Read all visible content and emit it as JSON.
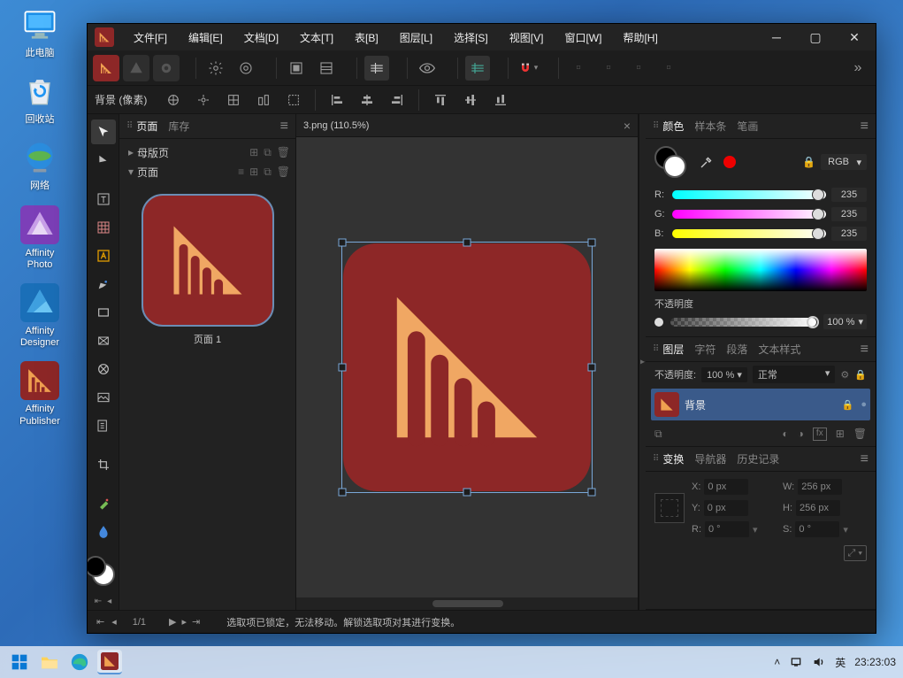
{
  "desktop": {
    "icons": [
      {
        "name": "此电脑"
      },
      {
        "name": "回收站"
      },
      {
        "name": "网络"
      },
      {
        "name": "Affinity\nPhoto"
      },
      {
        "name": "Affinity\nDesigner"
      },
      {
        "name": "Affinity\nPublisher"
      }
    ]
  },
  "menubar": {
    "items": [
      "文件[F]",
      "编辑[E]",
      "文档[D]",
      "文本[T]",
      "表[B]",
      "图层[L]",
      "选择[S]",
      "视图[V]",
      "窗口[W]",
      "帮助[H]"
    ]
  },
  "context": {
    "label": "背景 (像素)"
  },
  "pages_panel": {
    "tabs": [
      "页面",
      "库存"
    ],
    "tree": {
      "master": "母版页",
      "pages": "页面"
    },
    "thumb_label": "页面 1"
  },
  "document": {
    "tab": "3.png (110.5%)"
  },
  "color_panel": {
    "tabs": [
      "颜色",
      "样本条",
      "笔画"
    ],
    "mode": "RGB",
    "channels": [
      {
        "label": "R:",
        "value": "235"
      },
      {
        "label": "G:",
        "value": "235"
      },
      {
        "label": "B:",
        "value": "235"
      }
    ],
    "opacity_label": "不透明度",
    "opacity_value": "100 %"
  },
  "layers_panel": {
    "tabs": [
      "图层",
      "字符",
      "段落",
      "文本样式"
    ],
    "opacity_label": "不透明度:",
    "opacity_value": "100 %",
    "blend": "正常",
    "layer_name": "背景"
  },
  "transform_panel": {
    "tabs": [
      "变换",
      "导航器",
      "历史记录"
    ],
    "x_label": "X:",
    "x_val": "0 px",
    "y_label": "Y:",
    "y_val": "0 px",
    "w_label": "W:",
    "w_val": "256 px",
    "h_label": "H:",
    "h_val": "256 px",
    "r_label": "R:",
    "r_val": "0 °",
    "s_label": "S:",
    "s_val": "0 °"
  },
  "status": {
    "page": "1/1",
    "message": "选取项已锁定，无法移动。解锁选取项对其进行变换。"
  },
  "taskbar": {
    "ime": "英",
    "time": "23:23:03"
  }
}
